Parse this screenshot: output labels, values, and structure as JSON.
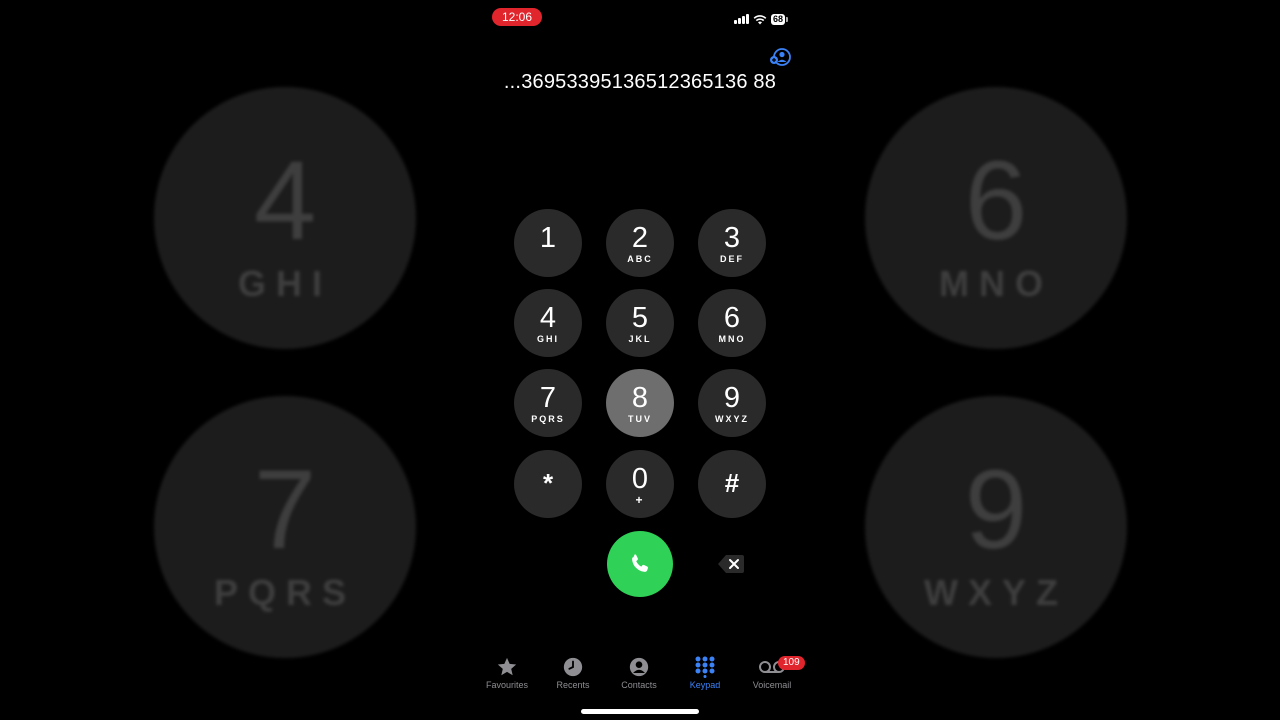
{
  "status_bar": {
    "time": "12:06",
    "battery": "68"
  },
  "dial_number": "...36953395136512365136 88",
  "keypad": [
    {
      "digit": "1",
      "letters": ""
    },
    {
      "digit": "2",
      "letters": "ABC"
    },
    {
      "digit": "3",
      "letters": "DEF"
    },
    {
      "digit": "4",
      "letters": "GHI"
    },
    {
      "digit": "5",
      "letters": "JKL"
    },
    {
      "digit": "6",
      "letters": "MNO"
    },
    {
      "digit": "7",
      "letters": "PQRS"
    },
    {
      "digit": "8",
      "letters": "TUV"
    },
    {
      "digit": "9",
      "letters": "WXYZ"
    },
    {
      "digit": "*",
      "letters": ""
    },
    {
      "digit": "0",
      "letters": "+"
    },
    {
      "digit": "#",
      "letters": ""
    }
  ],
  "background_keys": [
    {
      "digit": "4",
      "letters": "GHI"
    },
    {
      "digit": "6",
      "letters": "MNO"
    },
    {
      "digit": "7",
      "letters": "PQRS"
    },
    {
      "digit": "9",
      "letters": "WXYZ"
    }
  ],
  "tabs": [
    {
      "label": "Favourites",
      "icon": "star-icon"
    },
    {
      "label": "Recents",
      "icon": "clock-icon"
    },
    {
      "label": "Contacts",
      "icon": "person-circle-icon"
    },
    {
      "label": "Keypad",
      "icon": "keypad-icon",
      "selected": true
    },
    {
      "label": "Voicemail",
      "icon": "voicemail-icon",
      "badge": "109"
    }
  ],
  "colors": {
    "accent": "#3b82f6",
    "call": "#2fd157",
    "badge": "#e1252d"
  }
}
